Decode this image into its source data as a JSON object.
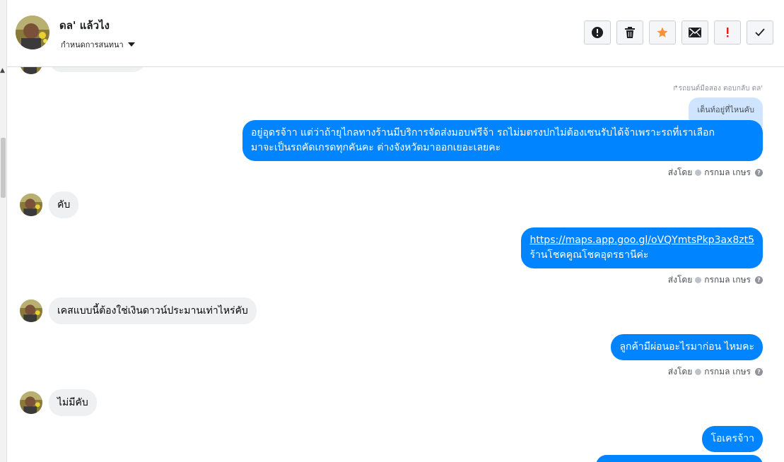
{
  "header": {
    "contact_name": "ดล' แล้วไง",
    "conversation_menu_label": "กำหนดการสนทนา",
    "actions": [
      {
        "name": "report-button",
        "icon": "exclamation-circle-icon"
      },
      {
        "name": "delete-button",
        "icon": "trash-icon"
      },
      {
        "name": "star-button",
        "icon": "star-icon",
        "color": "#f7923b"
      },
      {
        "name": "mark-unread-button",
        "icon": "envelope-icon"
      },
      {
        "name": "important-button",
        "icon": "exclamation-icon",
        "color": "#e02020"
      },
      {
        "name": "mark-done-button",
        "icon": "check-icon"
      }
    ]
  },
  "messages": {
    "reply_meta": "↱รถยนต์มือสอง ตอบกลับ ดล'",
    "quoted_text": "เต็นท์อยู่ที่ไหนคับ",
    "out_1_line1": "อยู่อุดรจ้าา แต่ว่าถ้ายุไกลทางร้านมีบริการจัดส่งมอบฟรีจ้า รถไม่มตรงปกไม่ต้องเซนรับได้จ้าเพราะรถที่เราเลือก",
    "out_1_line2": "มาจะเป็นรถคัดเกรดทุกคันคะ ต่างจังหวัดมาออกเยอะเลยคะ",
    "in_1": "คับ",
    "out_2_link": "https://maps.app.goo.gl/oVQYmtsPkp3ax8zt5",
    "out_2_text": "ร้านโชคคูณโชคอุดรธานีค่ะ",
    "in_2": "เคสแบบนี้ต้องใช่เงินดาวน์ประมานเท่าไหร่คับ",
    "out_3": "ลูกค้ามีผ่อนอะไรมาก่อน ไหมคะ",
    "in_3": "ไม่มีคับ",
    "out_4": "โอเครจ้าา",
    "sent_by_label": "ส่งโดย",
    "sent_by_name": "กรกมล เกษร",
    "help_glyph": "?"
  },
  "colors": {
    "outgoing_bubble": "#0084ff",
    "incoming_bubble": "#eff0f1",
    "quoted_bubble": "#cfe5ff"
  }
}
